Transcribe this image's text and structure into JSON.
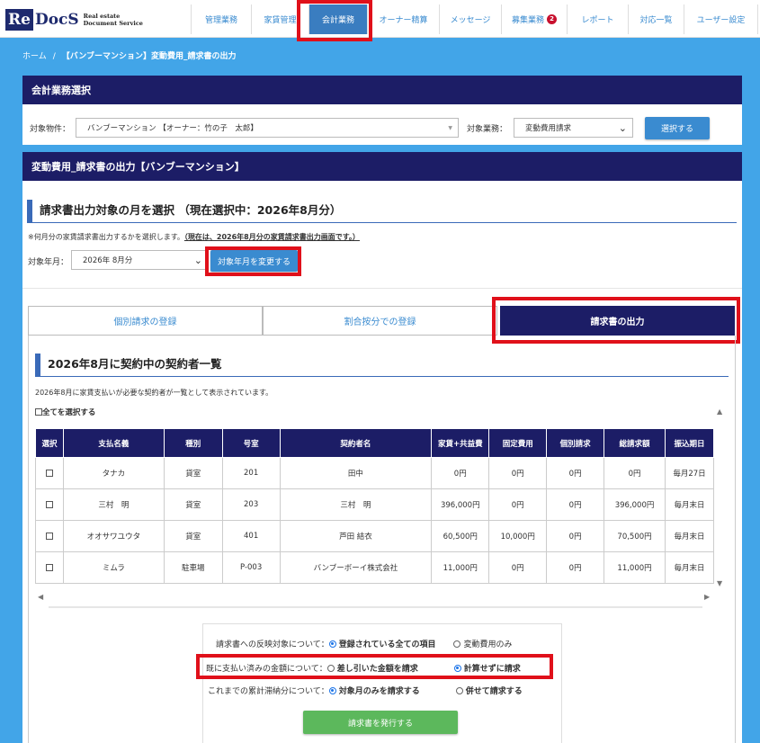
{
  "header": {
    "logo_re": "Re",
    "logo_docs": "DocS",
    "logo_sub_1": "Real estate",
    "logo_sub_2": "Document Service",
    "nav": [
      {
        "label": "管理業務",
        "badge": ""
      },
      {
        "label": "家賃管理",
        "badge": ""
      },
      {
        "label": "会計業務",
        "badge": ""
      },
      {
        "label": "オーナー精算",
        "badge": ""
      },
      {
        "label": "メッセージ",
        "badge": ""
      },
      {
        "label": "募集業務",
        "badge": "2"
      },
      {
        "label": "レポート",
        "badge": ""
      },
      {
        "label": "対応一覧",
        "badge": ""
      },
      {
        "label": "ユーザー設定",
        "badge": ""
      }
    ]
  },
  "breadcrumb": {
    "home": "ホーム",
    "sep": "/",
    "current": "【バンブーマンション】変動費用_請求書の出力"
  },
  "selection": {
    "title": "会計業務選択",
    "property_label": "対象物件：",
    "property_value": "バンブーマンション 【オーナー：竹の子　太郎】",
    "task_label": "対象業務：",
    "task_value": "変動費用請求",
    "select_button": "選択する"
  },
  "invoice": {
    "title": "変動費用_請求書の出力【バンブーマンション】",
    "month_section_title": "請求書出力対象の月を選択 （現在選択中：2026年8月分）",
    "note_prefix": "※何月分の家賃請求書出力するかを選択します。",
    "note_emphasis": "（現在は、2026年8月分の家賃請求書出力画面です。）",
    "month_label": "対象年月：",
    "month_value": "2026年 8月分",
    "change_month_button": "対象年月を変更する"
  },
  "tabs": [
    {
      "label": "個別請求の登録"
    },
    {
      "label": "割合按分での登録"
    },
    {
      "label": "請求書の出力"
    }
  ],
  "contractors": {
    "title": "2026年8月に契約中の契約者一覧",
    "description": "2026年8月に家賃支払いが必要な契約者が一覧として表示されています。",
    "select_all_label": "全てを選択する",
    "columns": [
      "選択",
      "支払名義",
      "種別",
      "号室",
      "契約者名",
      "家賃+共益費",
      "固定費用",
      "個別請求",
      "総請求額",
      "振込期日"
    ],
    "rows": [
      {
        "payer": "タナカ",
        "kind": "貸室",
        "room": "201",
        "name": "田中",
        "rent": "0円",
        "fixed": "0円",
        "individual": "0円",
        "total": "0円",
        "due": "毎月27日"
      },
      {
        "payer": "三村　明",
        "kind": "貸室",
        "room": "203",
        "name": "三村　明",
        "rent": "396,000円",
        "fixed": "0円",
        "individual": "0円",
        "total": "396,000円",
        "due": "毎月末日"
      },
      {
        "payer": "オオサワユウタ",
        "kind": "貸室",
        "room": "401",
        "name": "芦田 結衣",
        "rent": "60,500円",
        "fixed": "10,000円",
        "individual": "0円",
        "total": "70,500円",
        "due": "毎月末日"
      },
      {
        "payer": "ミムラ",
        "kind": "駐車場",
        "room": "P-003",
        "name": "バンブーボーイ株式会社",
        "rent": "11,000円",
        "fixed": "0円",
        "individual": "0円",
        "total": "11,000円",
        "due": "毎月末日"
      }
    ]
  },
  "options": {
    "reflect_label": "請求書への反映対象について：",
    "reflect_opt1": "登録されている全ての項目",
    "reflect_opt2": "変動費用のみ",
    "paid_label": "既に支払い済みの金額について：",
    "paid_opt1": "差し引いた金額を請求",
    "paid_opt2": "計算せずに請求",
    "arrears_label": "これまでの累計滞納分について：",
    "arrears_opt1": "対象月のみを請求する",
    "arrears_opt2": "併せて請求する",
    "issue_button": "請求書を発行する"
  }
}
